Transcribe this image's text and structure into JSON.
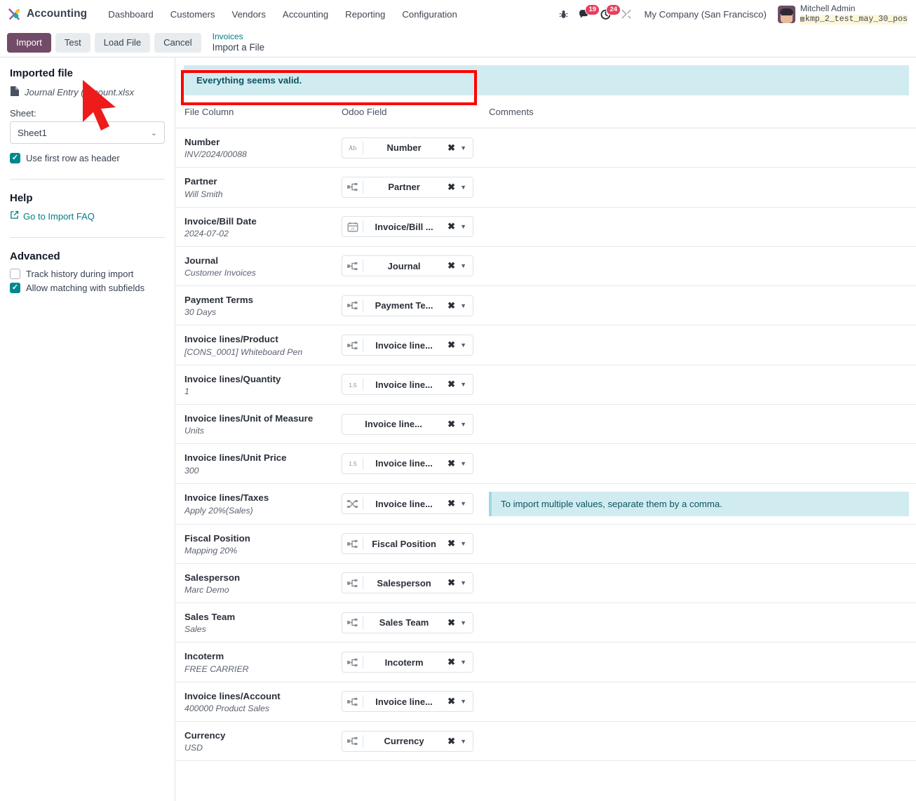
{
  "navbar": {
    "brand": "Accounting",
    "menu": [
      "Dashboard",
      "Customers",
      "Vendors",
      "Accounting",
      "Reporting",
      "Configuration"
    ],
    "icons": {
      "debug": "bug-icon",
      "messages": "chat-icon",
      "activities": "clock-icon",
      "tools": "wrench-icon"
    },
    "messages_count": "19",
    "activities_count": "24",
    "company": "My Company (San Francisco)",
    "user_name": "Mitchell Admin",
    "user_db": "kmp_2_test_may_30_pos"
  },
  "controlbar": {
    "import_label": "Import",
    "test_label": "Test",
    "load_file_label": "Load File",
    "cancel_label": "Cancel",
    "breadcrumb_parent": "Invoices",
    "breadcrumb_current": "Import a File"
  },
  "sidebar": {
    "imported_file_title": "Imported file",
    "file_icon": "file-icon",
    "file_name": "Journal Entry (account.xlsx",
    "sheet_label": "Sheet:",
    "sheet_value": "Sheet1",
    "sheet_options": [
      "Sheet1"
    ],
    "use_first_row_label": "Use first row as header",
    "use_first_row_checked": true,
    "help_title": "Help",
    "help_link": "Go to Import FAQ",
    "help_link_icon": "external-link-icon",
    "advanced_title": "Advanced",
    "track_history_label": "Track history during import",
    "track_history_checked": false,
    "allow_matching_label": "Allow matching with subfields",
    "allow_matching_checked": true
  },
  "alert": {
    "text": "Everything seems valid.",
    "bg_color": "#d1ecf1",
    "text_color": "#0c5460",
    "highlight_color": "#fd0000"
  },
  "table": {
    "headers": [
      "File Column",
      "Odoo Field",
      "Comments"
    ],
    "rows": [
      {
        "file_column": "Number",
        "sample": "INV/2024/00088",
        "odoo_field": "Number",
        "field_icon": "text-ab-icon",
        "comment": ""
      },
      {
        "file_column": "Partner",
        "sample": "Will Smith",
        "odoo_field": "Partner",
        "field_icon": "many2one-icon",
        "comment": ""
      },
      {
        "file_column": "Invoice/Bill Date",
        "sample": "2024-07-02",
        "odoo_field": "Invoice/Bill ...",
        "field_icon": "calendar-icon",
        "comment": ""
      },
      {
        "file_column": "Journal",
        "sample": "Customer Invoices",
        "odoo_field": "Journal",
        "field_icon": "many2one-icon",
        "comment": ""
      },
      {
        "file_column": "Payment Terms",
        "sample": "30 Days",
        "odoo_field": "Payment Te...",
        "field_icon": "many2one-icon",
        "comment": ""
      },
      {
        "file_column": "Invoice lines/Product",
        "sample": "[CONS_0001] Whiteboard Pen",
        "odoo_field": "Invoice line...",
        "field_icon": "many2one-icon",
        "comment": ""
      },
      {
        "file_column": "Invoice lines/Quantity",
        "sample": "1",
        "odoo_field": "Invoice line...",
        "field_icon": "float-icon",
        "comment": ""
      },
      {
        "file_column": "Invoice lines/Unit of Measure",
        "sample": "Units",
        "odoo_field": "Invoice line...",
        "field_icon": "none",
        "comment": ""
      },
      {
        "file_column": "Invoice lines/Unit Price",
        "sample": "300",
        "odoo_field": "Invoice line...",
        "field_icon": "float-icon",
        "comment": ""
      },
      {
        "file_column": "Invoice lines/Taxes",
        "sample": "Apply 20%(Sales)",
        "odoo_field": "Invoice line...",
        "field_icon": "many2many-icon",
        "comment": "To import multiple values, separate them by a comma."
      },
      {
        "file_column": "Fiscal Position",
        "sample": "Mapping 20%",
        "odoo_field": "Fiscal Position",
        "field_icon": "many2one-icon",
        "comment": ""
      },
      {
        "file_column": "Salesperson",
        "sample": "Marc Demo",
        "odoo_field": "Salesperson",
        "field_icon": "many2one-icon",
        "comment": ""
      },
      {
        "file_column": "Sales Team",
        "sample": "Sales",
        "odoo_field": "Sales Team",
        "field_icon": "many2one-icon",
        "comment": ""
      },
      {
        "file_column": "Incoterm",
        "sample": "FREE CARRIER",
        "odoo_field": "Incoterm",
        "field_icon": "many2one-icon",
        "comment": ""
      },
      {
        "file_column": "Invoice lines/Account",
        "sample": "400000 Product Sales",
        "odoo_field": "Invoice line...",
        "field_icon": "many2one-icon",
        "comment": ""
      },
      {
        "file_column": "Currency",
        "sample": "USD",
        "odoo_field": "Currency",
        "field_icon": "many2one-icon",
        "comment": ""
      }
    ],
    "field_clear_label": "✖",
    "field_caret_label": "▼"
  },
  "theme": {
    "primary": "#714B67",
    "link": "#017e84",
    "accent_check": "#00888f"
  }
}
